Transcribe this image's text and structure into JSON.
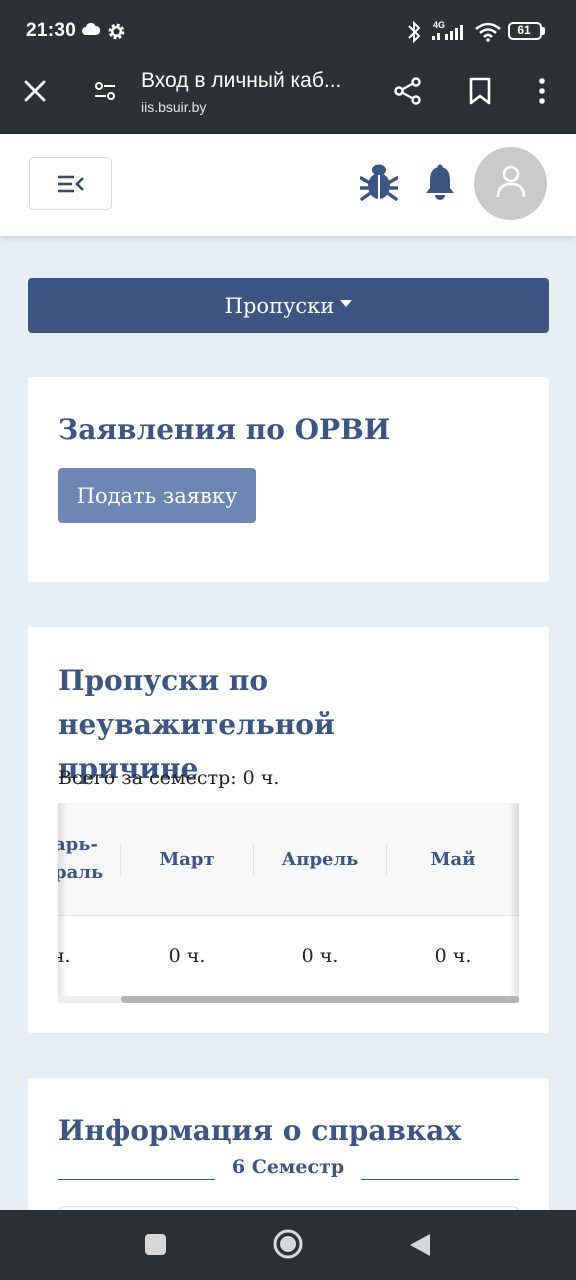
{
  "status_bar": {
    "time": "21:30",
    "network": "4G",
    "battery": "61",
    "icons": [
      "cloud-icon",
      "gear-icon",
      "bluetooth-icon",
      "signal-icon",
      "wifi-icon",
      "battery-icon"
    ]
  },
  "browser": {
    "title": "Вход в личный каб...",
    "url": "iis.bsuir.by",
    "icons": [
      "close-icon",
      "site-settings-icon",
      "share-icon",
      "bookmark-icon",
      "more-vert-icon"
    ]
  },
  "header": {
    "icons": [
      "menu-collapse-icon",
      "bug-icon",
      "bell-icon",
      "user-icon"
    ]
  },
  "dropdown": {
    "label": "Пропуски"
  },
  "orvi_card": {
    "title": "Заявления по ОРВИ",
    "button_label": "Подать заявку"
  },
  "absence_card": {
    "title_line1": "Пропуски по неуважительной",
    "title_line2": "причине",
    "total": "Всего за семестр: 0 ч.",
    "table": {
      "partial_header_line1": "арь-",
      "partial_header_line2": "раль",
      "headers": [
        "Март",
        "Апрель",
        "Май"
      ],
      "partial_value": "ч.",
      "values": [
        "0 ч.",
        "0 ч.",
        "0 ч."
      ]
    }
  },
  "certs_card": {
    "title": "Информация о справках",
    "semester": "6 Семестр"
  },
  "colors": {
    "primary": "#3d5582",
    "button_light": "#6d87b5",
    "background": "#e9edf4",
    "system_bar": "#2f3032"
  }
}
